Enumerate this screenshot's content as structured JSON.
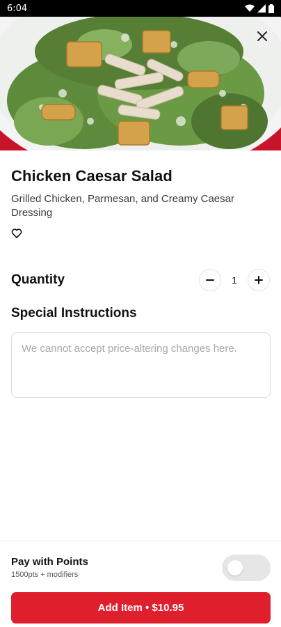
{
  "status_bar": {
    "time": "6:04",
    "icons": [
      "wifi-icon",
      "cellular-icon",
      "battery-icon"
    ]
  },
  "hero": {
    "image_subject": "chicken caesar salad with croutons in a white bowl",
    "close_icon": "close-icon"
  },
  "item": {
    "title": "Chicken Caesar Salad",
    "description": "Grilled Chicken, Parmesan, and Creamy Caesar Dressing",
    "favorite_icon": "heart-outline-icon"
  },
  "quantity": {
    "label": "Quantity",
    "value": "1",
    "decrement_icon": "minus-icon",
    "increment_icon": "plus-icon"
  },
  "instructions": {
    "label": "Special Instructions",
    "placeholder": "We cannot accept price-altering changes here.",
    "value": ""
  },
  "points": {
    "label": "Pay with Points",
    "subtext": "1500pts + modifiers",
    "toggle_on": false
  },
  "cta": {
    "label": "Add Item • $10.95"
  },
  "colors": {
    "accent": "#e01f2d",
    "text": "#111111",
    "muted": "#a8a8a8"
  }
}
